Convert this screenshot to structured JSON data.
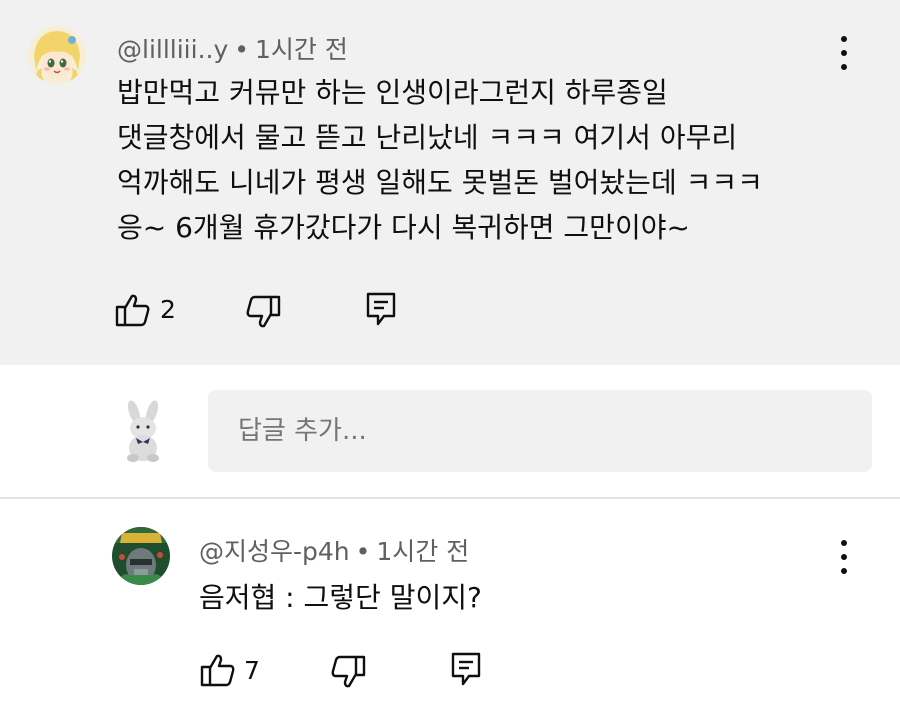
{
  "comment": {
    "author": "@lillliii..y",
    "time": "1시간 전",
    "lines": [
      "밥만먹고 커뮤만 하는 인생이라그런지 하루종일",
      "댓글창에서 물고 뜯고 난리났네 ㅋㅋㅋ 여기서 아무리",
      "억까해도 니네가 평생 일해도 못벌돈 벌어놨는데 ㅋㅋㅋ",
      "응~ 6개월 휴가갔다가 다시 복귀하면 그만이야~"
    ],
    "likes": "2",
    "icons": [
      "thumb-up-icon",
      "thumb-down-icon",
      "reply-icon",
      "more-vert-icon"
    ]
  },
  "reply_box": {
    "placeholder": "답글 추가..."
  },
  "reply": {
    "author": "@지성우-p4h",
    "time": "1시간 전",
    "text": "음저협 : 그렇단 말이지?",
    "likes": "7"
  },
  "separator": "•"
}
